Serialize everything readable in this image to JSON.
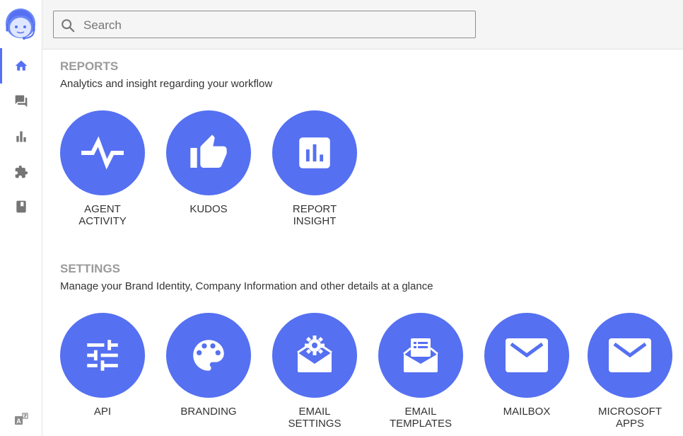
{
  "search": {
    "placeholder": "Search",
    "value": ""
  },
  "sidebar": {
    "items": [
      {
        "icon": "home-icon",
        "active": true
      },
      {
        "icon": "chat-icon",
        "active": false
      },
      {
        "icon": "bar-chart-icon",
        "active": false
      },
      {
        "icon": "puzzle-icon",
        "active": false
      },
      {
        "icon": "bookmark-icon",
        "active": false
      }
    ]
  },
  "sections": {
    "reports": {
      "title": "REPORTS",
      "description": "Analytics and insight regarding your workflow",
      "tiles": [
        {
          "line1": "AGENT",
          "line2": "ACTIVITY",
          "icon": "activity-icon"
        },
        {
          "line1": "KUDOS",
          "line2": "",
          "icon": "thumbs-up-icon"
        },
        {
          "line1": "REPORT",
          "line2": "INSIGHT",
          "icon": "report-chart-icon"
        }
      ]
    },
    "settings": {
      "title": "SETTINGS",
      "description": "Manage your Brand Identity, Company Information and other details at a glance",
      "tiles": [
        {
          "line1": "API",
          "line2": "",
          "icon": "sliders-icon"
        },
        {
          "line1": "BRANDING",
          "line2": "",
          "icon": "palette-icon"
        },
        {
          "line1": "EMAIL",
          "line2": "SETTINGS",
          "icon": "email-settings-icon"
        },
        {
          "line1": "EMAIL",
          "line2": "TEMPLATES",
          "icon": "email-template-icon"
        },
        {
          "line1": "MAILBOX",
          "line2": "",
          "icon": "mail-icon"
        },
        {
          "line1": "MICROSOFT",
          "line2": "APPS",
          "icon": "mail-icon"
        }
      ]
    }
  },
  "colors": {
    "accent": "#5570f1",
    "sidebar_icon": "#757575",
    "section_title": "#9b9b9b",
    "topbar_bg": "#f5f5f5"
  }
}
